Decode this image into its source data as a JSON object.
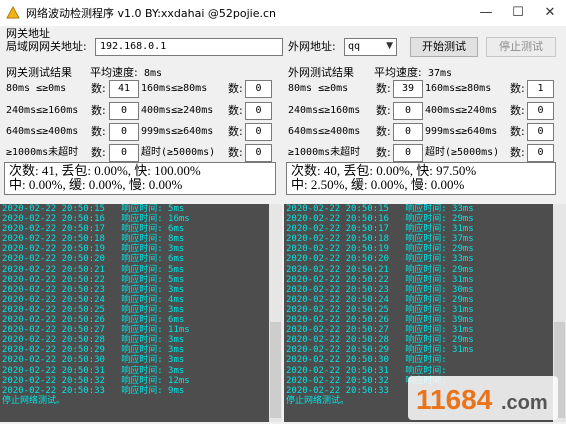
{
  "window": {
    "title": "网络波动检测程序 v1.0  BY:xxdahai  @52pojie.cn",
    "min_label": "—",
    "max_label": "☐",
    "close_label": "✕"
  },
  "gateway_section": {
    "label": "网关地址"
  },
  "lan_gateway": {
    "label": "局域网网关地址:",
    "value": "192.168.0.1"
  },
  "wan_address": {
    "label": "外网地址:",
    "selected": "qq"
  },
  "buttons": {
    "start": "开始测试",
    "stop": "停止测试"
  },
  "gateway_results": {
    "title": "网关测试结果",
    "avg_label": "平均速度:",
    "avg_value": "8ms",
    "rows": [
      {
        "a_label": "80ms ≤≥0ms",
        "a_sub": "数:",
        "a_value": "41",
        "b_label": "160ms≤≥80ms",
        "b_sub": "数:",
        "b_value": "0"
      },
      {
        "a_label": "240ms≤≥160ms",
        "a_sub": "数:",
        "a_value": "0",
        "b_label": "400ms≤≥240ms",
        "b_sub": "数:",
        "b_value": "0"
      },
      {
        "a_label": "640ms≤≥400ms",
        "a_sub": "数:",
        "a_value": "0",
        "b_label": "999ms≤≥640ms",
        "b_sub": "数:",
        "b_value": "0"
      },
      {
        "a_label": "≥1000ms未超时",
        "a_sub": "数:",
        "a_value": "0",
        "b_label": "超时(≥5000ms)",
        "b_sub": "数:",
        "b_value": "0"
      }
    ],
    "summary_line1": "次数: 41, 丢包: 0.00%, 快: 100.00%",
    "summary_line2": "中: 0.00%, 缓: 0.00%, 慢: 0.00%"
  },
  "wan_results": {
    "title": "外网测试结果",
    "avg_label": "平均速度:",
    "avg_value": "37ms",
    "rows": [
      {
        "a_label": "80ms ≤≥0ms",
        "a_sub": "数:",
        "a_value": "39",
        "b_label": "160ms≤≥80ms",
        "b_sub": "数:",
        "b_value": "1"
      },
      {
        "a_label": "240ms≤≥160ms",
        "a_sub": "数:",
        "a_value": "0",
        "b_label": "400ms≤≥240ms",
        "b_sub": "数:",
        "b_value": "0"
      },
      {
        "a_label": "640ms≤≥400ms",
        "a_sub": "数:",
        "a_value": "0",
        "b_label": "999ms≤≥640ms",
        "b_sub": "数:",
        "b_value": "0"
      },
      {
        "a_label": "≥1000ms未超时",
        "a_sub": "数:",
        "a_value": "0",
        "b_label": "超时(≥5000ms)",
        "b_sub": "数:",
        "b_value": "0"
      }
    ],
    "summary_line1": "次数: 40, 丢包: 0.00%, 快: 97.50%",
    "summary_line2": "中: 2.50%, 缓: 0.00%, 慢: 0.00%"
  },
  "gateway_log": {
    "lines": [
      "2020-02-22 20:50:15   响应时间: 5ms",
      "2020-02-22 20:50:16   响应时间: 16ms",
      "2020-02-22 20:50:17   响应时间: 6ms",
      "2020-02-22 20:50:18   响应时间: 8ms",
      "2020-02-22 20:50:19   响应时间: 3ms",
      "2020-02-22 20:50:20   响应时间: 6ms",
      "2020-02-22 20:50:21   响应时间: 5ms",
      "2020-02-22 20:50:22   响应时间: 5ms",
      "2020-02-22 20:50:23   响应时间: 3ms",
      "2020-02-22 20:50:24   响应时间: 4ms",
      "2020-02-22 20:50:25   响应时间: 3ms",
      "2020-02-22 20:50:26   响应时间: 6ms",
      "2020-02-22 20:50:27   响应时间: 11ms",
      "2020-02-22 20:50:28   响应时间: 3ms",
      "2020-02-22 20:50:29   响应时间: 3ms",
      "2020-02-22 20:50:30   响应时间: 3ms",
      "2020-02-22 20:50:31   响应时间: 3ms",
      "2020-02-22 20:50:32   响应时间: 12ms",
      "2020-02-22 20:50:33   响应时间: 9ms",
      "停止网络测试。"
    ]
  },
  "wan_log": {
    "lines": [
      "2020-02-22 20:50:15   响应时间: 33ms",
      "2020-02-22 20:50:16   响应时间: 29ms",
      "2020-02-22 20:50:17   响应时间: 31ms",
      "2020-02-22 20:50:18   响应时间: 37ms",
      "2020-02-22 20:50:19   响应时间: 29ms",
      "2020-02-22 20:50:20   响应时间: 33ms",
      "2020-02-22 20:50:21   响应时间: 29ms",
      "2020-02-22 20:50:22   响应时间: 31ms",
      "2020-02-22 20:50:23   响应时间: 30ms",
      "2020-02-22 20:50:24   响应时间: 29ms",
      "2020-02-22 20:50:25   响应时间: 31ms",
      "2020-02-22 20:50:26   响应时间: 39ms",
      "2020-02-22 20:50:27   响应时间: 31ms",
      "2020-02-22 20:50:28   响应时间: 29ms",
      "2020-02-22 20:50:29   响应时间: 31ms",
      "2020-02-22 20:50:30   响应时间: ",
      "2020-02-22 20:50:31   响应时间: ",
      "2020-02-22 20:50:32   响应时间: ",
      "2020-02-22 20:50:33   ",
      "停止网络测试。"
    ]
  },
  "watermark": {
    "text": "11684.com"
  },
  "icons": {
    "app": "app-icon",
    "dropdown": "chevron-down-icon"
  },
  "colors": {
    "log_bg": "#4d4d4d",
    "log_text": "#00e5e5",
    "watermark_orange": "#e8741c"
  }
}
